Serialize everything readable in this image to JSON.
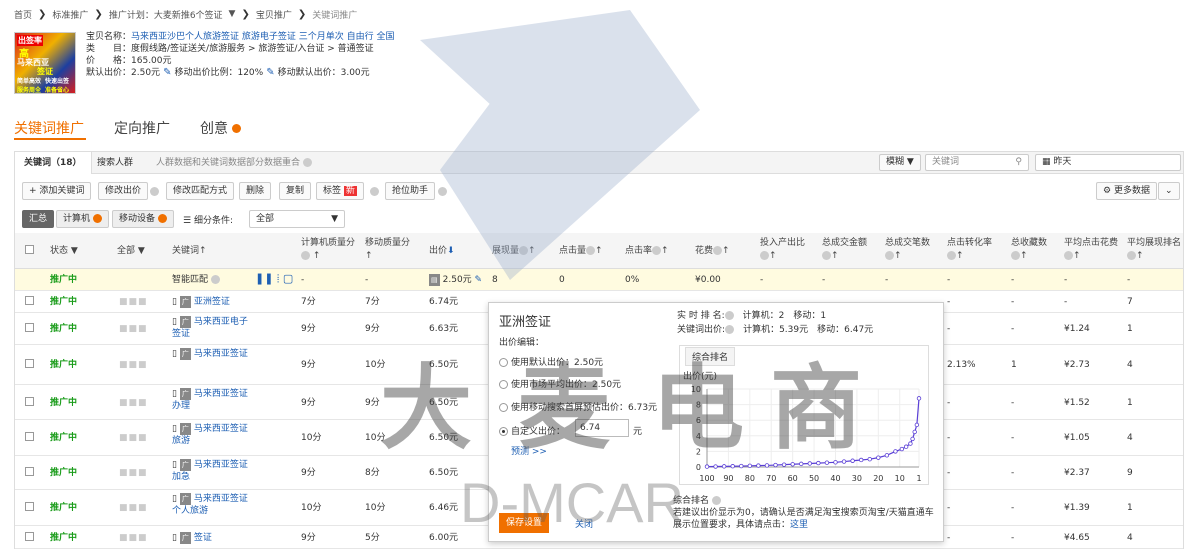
{
  "breadcrumb": [
    "首页",
    "标准推广",
    "推广计划：大麦新推6个签证",
    "宝贝推广",
    "关键词推广"
  ],
  "breadcrumb_dropdown": "▼",
  "product": {
    "img_text": [
      "出签率",
      "高",
      "马来西亚",
      "签证",
      "简单高效",
      "快速出签",
      "服务周全",
      "准备省心"
    ],
    "name_label": "宝贝名称：",
    "name": "马来西亚沙巴个人旅游签证 旅游电子签证 三个月单次 自由行 全国",
    "category_label": "类　　目：",
    "category": "度假线路/签证送关/旅游服务 > 旅游签证/入台证 > 普通签证",
    "price_label": "价　　格：",
    "price": "165.00元",
    "default_bid_label": "默认出价：",
    "default_bid": "2.50元",
    "mobile_ratio_label": "移动出价比例：",
    "mobile_ratio": "120%",
    "mobile_default_label": "移动默认出价：",
    "mobile_default": "3.00元"
  },
  "main_tabs": [
    "关键词推广",
    "定向推广",
    "创意"
  ],
  "sub_tabs": {
    "keywords": "关键词（18）",
    "search_crowd": "搜索人群",
    "info": "人群数据和关键词数据部分数据重合"
  },
  "search": {
    "mode": "模糊",
    "placeholder": "关键词",
    "date": "昨天"
  },
  "toolbar": [
    "+ 添加关键词",
    "修改出价",
    "修改匹配方式",
    "删除",
    "复制",
    "标签",
    "抢位助手"
  ],
  "new_badge": "新",
  "more_data": "更多数据",
  "filter": {
    "summary": "汇总",
    "pc": "计算机",
    "mobile": "移动设备",
    "cond_label": "细分条件:",
    "cond_value": "全部"
  },
  "headers": [
    "状态",
    "全部",
    "关键词",
    "计算机质量分",
    "移动质量分",
    "出价",
    "展现量",
    "点击量",
    "点击率",
    "花费",
    "投入产出比",
    "总成交金额",
    "总成交笔数",
    "点击转化率",
    "总收藏数",
    "平均点击花费",
    "平均展现排名"
  ],
  "smart_row": {
    "status": "推广中",
    "keyword": "智能匹配",
    "pcq": "-",
    "mq": "-",
    "bid": "2.50元",
    "imp": "8",
    "clk": "0",
    "ctr": "0%",
    "cost": "¥0.00",
    "r1": "-",
    "r2": "-",
    "r3": "-",
    "r4": "-",
    "r5": "-",
    "r6": "-",
    "r7": "-"
  },
  "rows": [
    {
      "status": "推广中",
      "kw": "亚洲签证",
      "pcq": "7分",
      "mq": "7分",
      "bid": "6.74元",
      "cvr": "-",
      "fav": "-",
      "cpc": "-",
      "rank": "7"
    },
    {
      "status": "推广中",
      "kw": "马来西亚电子签证",
      "pcq": "9分",
      "mq": "9分",
      "bid": "6.63元",
      "cvr": "-",
      "fav": "-",
      "cpc": "¥1.24",
      "rank": "1"
    },
    {
      "status": "推广中",
      "kw": "马来西亚签证",
      "pcq": "9分",
      "mq": "10分",
      "bid": "6.50元",
      "cvr": "2.13%",
      "fav": "1",
      "cpc": "¥2.73",
      "rank": "4"
    },
    {
      "status": "推广中",
      "kw": "马来西亚签证办理",
      "pcq": "9分",
      "mq": "9分",
      "bid": "6.50元",
      "cvr": "-",
      "fav": "-",
      "cpc": "¥1.52",
      "rank": "1"
    },
    {
      "status": "推广中",
      "kw": "马来西亚签证 旅游",
      "pcq": "10分",
      "mq": "10分",
      "bid": "6.50元",
      "cvr": "-",
      "fav": "-",
      "cpc": "¥1.05",
      "rank": "4"
    },
    {
      "status": "推广中",
      "kw": "马来西亚签证加急",
      "pcq": "9分",
      "mq": "8分",
      "bid": "6.50元",
      "cvr": "-",
      "fav": "-",
      "cpc": "¥2.37",
      "rank": "9"
    },
    {
      "status": "推广中",
      "kw": "马来西亚签证个人旅游",
      "pcq": "10分",
      "mq": "10分",
      "bid": "6.46元",
      "cvr": "-",
      "fav": "-",
      "cpc": "¥1.39",
      "rank": "1"
    },
    {
      "status": "推广中",
      "kw": "签证",
      "pcq": "9分",
      "mq": "5分",
      "bid": "6.00元",
      "cvr": "-",
      "fav": "-",
      "cpc": "¥4.65",
      "rank": "4"
    }
  ],
  "popup": {
    "title": "亚洲签证",
    "edit_label": "出价编辑：",
    "opt1": "使用默认出价：2.50元",
    "opt2": "使用市场平均出价：2.50元",
    "opt3": "使用移动搜索首屏预估出价：6.73元",
    "opt4": "自定义出价：",
    "custom_value": "6.74",
    "unit": "元",
    "predict": "预测 >>",
    "save": "保存设置",
    "close": "关闭",
    "rt_rank": "实 时 排 名:",
    "rt_pc": "计算机：2",
    "rt_mobile": "移动：1",
    "kw_bid": "关键词出价:",
    "bid_pc": "计算机：5.39元",
    "bid_mobile": "移动：6.47元",
    "chart_tab": "综合排名",
    "foot_title": "综合排名",
    "foot_text": "若建议出价显示为0，请确认是否满足淘宝搜索页淘宝/天猫直通车展示位置要求，具体请点击：",
    "foot_link": "这里"
  },
  "chart_data": {
    "type": "line",
    "ylabel": "出价(元)",
    "yticks": [
      0,
      2,
      4,
      6,
      8,
      10
    ],
    "xticks": [
      100,
      90,
      80,
      70,
      60,
      50,
      40,
      30,
      20,
      10,
      1
    ],
    "ylim": [
      0,
      10
    ],
    "xlim": [
      100,
      1
    ],
    "x": [
      100,
      96,
      92,
      88,
      84,
      80,
      76,
      72,
      68,
      64,
      60,
      56,
      52,
      48,
      44,
      40,
      36,
      32,
      28,
      24,
      20,
      16,
      12,
      9,
      7,
      5,
      4,
      3,
      2,
      1
    ],
    "y": [
      0.05,
      0.06,
      0.08,
      0.1,
      0.12,
      0.15,
      0.18,
      0.2,
      0.25,
      0.3,
      0.35,
      0.4,
      0.45,
      0.5,
      0.55,
      0.6,
      0.7,
      0.8,
      0.9,
      1.0,
      1.2,
      1.5,
      2.0,
      2.3,
      2.6,
      3.0,
      3.6,
      4.5,
      5.4,
      8.8
    ]
  },
  "watermark": {
    "big": [
      "大",
      "麦",
      "电",
      "商"
    ],
    "small": "D-MCAR"
  }
}
